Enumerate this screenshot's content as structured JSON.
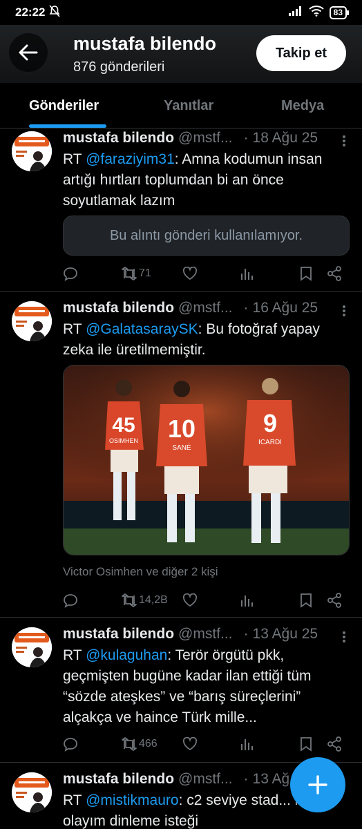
{
  "status_bar": {
    "time": "22:22",
    "battery": "83"
  },
  "profile": {
    "name": "mustafa bilendo",
    "post_count": "876 gönderileri",
    "follow_label": "Takip et"
  },
  "tabs": [
    {
      "label": "Gönderiler"
    },
    {
      "label": "Yanıtlar"
    },
    {
      "label": "Medya"
    }
  ],
  "posts": [
    {
      "name": "mustafa bilendo",
      "handle": "@mstf...",
      "dot": "·",
      "date": "18 Ağu 25",
      "rt": "RT",
      "mention": "@faraziyim31",
      "text": ": Amna kodumun insan artığı hırtları toplumdan bi an önce soyutlamak lazım",
      "quote": "Bu alıntı gönderi kullanılamıyor.",
      "retweets": "71"
    },
    {
      "name": "mustafa bilendo",
      "handle": "@mstf...",
      "dot": "·",
      "date": "16 Ağu 25",
      "rt": "RT",
      "mention": "@GalatasaraySK",
      "text": ": Bu fotoğraf yapay zeka ile üretilmemiştir.",
      "tagged": "Victor Osimhen ve diğer 2 kişi",
      "jerseys": [
        "45",
        "10",
        "9"
      ],
      "jersey_names": [
        "OSIMHEN",
        "SANÉ",
        "ICARDI"
      ],
      "retweets": "14,2B"
    },
    {
      "name": "mustafa bilendo",
      "handle": "@mstf...",
      "dot": "·",
      "date": "13 Ağu 25",
      "rt": "RT",
      "mention": "@kulaguhan",
      "text": ": Terör örgütü pkk, geçmişten bugüne kadar ilan ettiği tüm “sözde ateşkes” ve “barış süreçlerini” alçakça ve haince Türk mille...",
      "retweets": "466"
    },
    {
      "name": "mustafa bilendo",
      "handle": "@mstf...",
      "dot": "·",
      "date": "13 Ağ",
      "rt": "RT",
      "mention": "@mistikmauro",
      "text": ": c2 seviye stad... n olayım dinleme isteği"
    }
  ],
  "colors": {
    "accent": "#1d9bf0",
    "background": "#000000",
    "muted": "#71767b"
  }
}
